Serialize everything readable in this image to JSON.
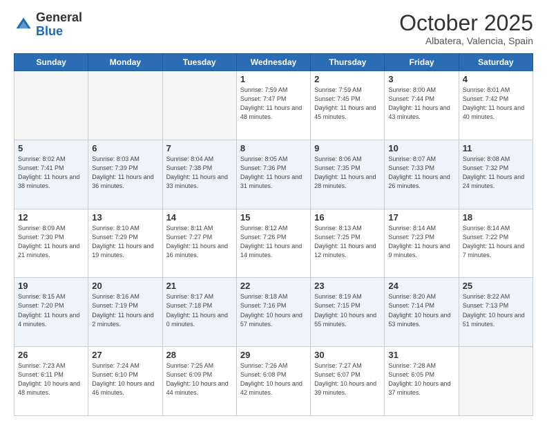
{
  "logo": {
    "general": "General",
    "blue": "Blue"
  },
  "header": {
    "month": "October 2025",
    "location": "Albatera, Valencia, Spain"
  },
  "weekdays": [
    "Sunday",
    "Monday",
    "Tuesday",
    "Wednesday",
    "Thursday",
    "Friday",
    "Saturday"
  ],
  "weeks": [
    [
      {
        "day": "",
        "info": ""
      },
      {
        "day": "",
        "info": ""
      },
      {
        "day": "",
        "info": ""
      },
      {
        "day": "1",
        "info": "Sunrise: 7:59 AM\nSunset: 7:47 PM\nDaylight: 11 hours\nand 48 minutes."
      },
      {
        "day": "2",
        "info": "Sunrise: 7:59 AM\nSunset: 7:45 PM\nDaylight: 11 hours\nand 45 minutes."
      },
      {
        "day": "3",
        "info": "Sunrise: 8:00 AM\nSunset: 7:44 PM\nDaylight: 11 hours\nand 43 minutes."
      },
      {
        "day": "4",
        "info": "Sunrise: 8:01 AM\nSunset: 7:42 PM\nDaylight: 11 hours\nand 40 minutes."
      }
    ],
    [
      {
        "day": "5",
        "info": "Sunrise: 8:02 AM\nSunset: 7:41 PM\nDaylight: 11 hours\nand 38 minutes."
      },
      {
        "day": "6",
        "info": "Sunrise: 8:03 AM\nSunset: 7:39 PM\nDaylight: 11 hours\nand 36 minutes."
      },
      {
        "day": "7",
        "info": "Sunrise: 8:04 AM\nSunset: 7:38 PM\nDaylight: 11 hours\nand 33 minutes."
      },
      {
        "day": "8",
        "info": "Sunrise: 8:05 AM\nSunset: 7:36 PM\nDaylight: 11 hours\nand 31 minutes."
      },
      {
        "day": "9",
        "info": "Sunrise: 8:06 AM\nSunset: 7:35 PM\nDaylight: 11 hours\nand 28 minutes."
      },
      {
        "day": "10",
        "info": "Sunrise: 8:07 AM\nSunset: 7:33 PM\nDaylight: 11 hours\nand 26 minutes."
      },
      {
        "day": "11",
        "info": "Sunrise: 8:08 AM\nSunset: 7:32 PM\nDaylight: 11 hours\nand 24 minutes."
      }
    ],
    [
      {
        "day": "12",
        "info": "Sunrise: 8:09 AM\nSunset: 7:30 PM\nDaylight: 11 hours\nand 21 minutes."
      },
      {
        "day": "13",
        "info": "Sunrise: 8:10 AM\nSunset: 7:29 PM\nDaylight: 11 hours\nand 19 minutes."
      },
      {
        "day": "14",
        "info": "Sunrise: 8:11 AM\nSunset: 7:27 PM\nDaylight: 11 hours\nand 16 minutes."
      },
      {
        "day": "15",
        "info": "Sunrise: 8:12 AM\nSunset: 7:26 PM\nDaylight: 11 hours\nand 14 minutes."
      },
      {
        "day": "16",
        "info": "Sunrise: 8:13 AM\nSunset: 7:25 PM\nDaylight: 11 hours\nand 12 minutes."
      },
      {
        "day": "17",
        "info": "Sunrise: 8:14 AM\nSunset: 7:23 PM\nDaylight: 11 hours\nand 9 minutes."
      },
      {
        "day": "18",
        "info": "Sunrise: 8:14 AM\nSunset: 7:22 PM\nDaylight: 11 hours\nand 7 minutes."
      }
    ],
    [
      {
        "day": "19",
        "info": "Sunrise: 8:15 AM\nSunset: 7:20 PM\nDaylight: 11 hours\nand 4 minutes."
      },
      {
        "day": "20",
        "info": "Sunrise: 8:16 AM\nSunset: 7:19 PM\nDaylight: 11 hours\nand 2 minutes."
      },
      {
        "day": "21",
        "info": "Sunrise: 8:17 AM\nSunset: 7:18 PM\nDaylight: 11 hours\nand 0 minutes."
      },
      {
        "day": "22",
        "info": "Sunrise: 8:18 AM\nSunset: 7:16 PM\nDaylight: 10 hours\nand 57 minutes."
      },
      {
        "day": "23",
        "info": "Sunrise: 8:19 AM\nSunset: 7:15 PM\nDaylight: 10 hours\nand 55 minutes."
      },
      {
        "day": "24",
        "info": "Sunrise: 8:20 AM\nSunset: 7:14 PM\nDaylight: 10 hours\nand 53 minutes."
      },
      {
        "day": "25",
        "info": "Sunrise: 8:22 AM\nSunset: 7:13 PM\nDaylight: 10 hours\nand 51 minutes."
      }
    ],
    [
      {
        "day": "26",
        "info": "Sunrise: 7:23 AM\nSunset: 6:11 PM\nDaylight: 10 hours\nand 48 minutes."
      },
      {
        "day": "27",
        "info": "Sunrise: 7:24 AM\nSunset: 6:10 PM\nDaylight: 10 hours\nand 46 minutes."
      },
      {
        "day": "28",
        "info": "Sunrise: 7:25 AM\nSunset: 6:09 PM\nDaylight: 10 hours\nand 44 minutes."
      },
      {
        "day": "29",
        "info": "Sunrise: 7:26 AM\nSunset: 6:08 PM\nDaylight: 10 hours\nand 42 minutes."
      },
      {
        "day": "30",
        "info": "Sunrise: 7:27 AM\nSunset: 6:07 PM\nDaylight: 10 hours\nand 39 minutes."
      },
      {
        "day": "31",
        "info": "Sunrise: 7:28 AM\nSunset: 6:05 PM\nDaylight: 10 hours\nand 37 minutes."
      },
      {
        "day": "",
        "info": ""
      }
    ]
  ]
}
